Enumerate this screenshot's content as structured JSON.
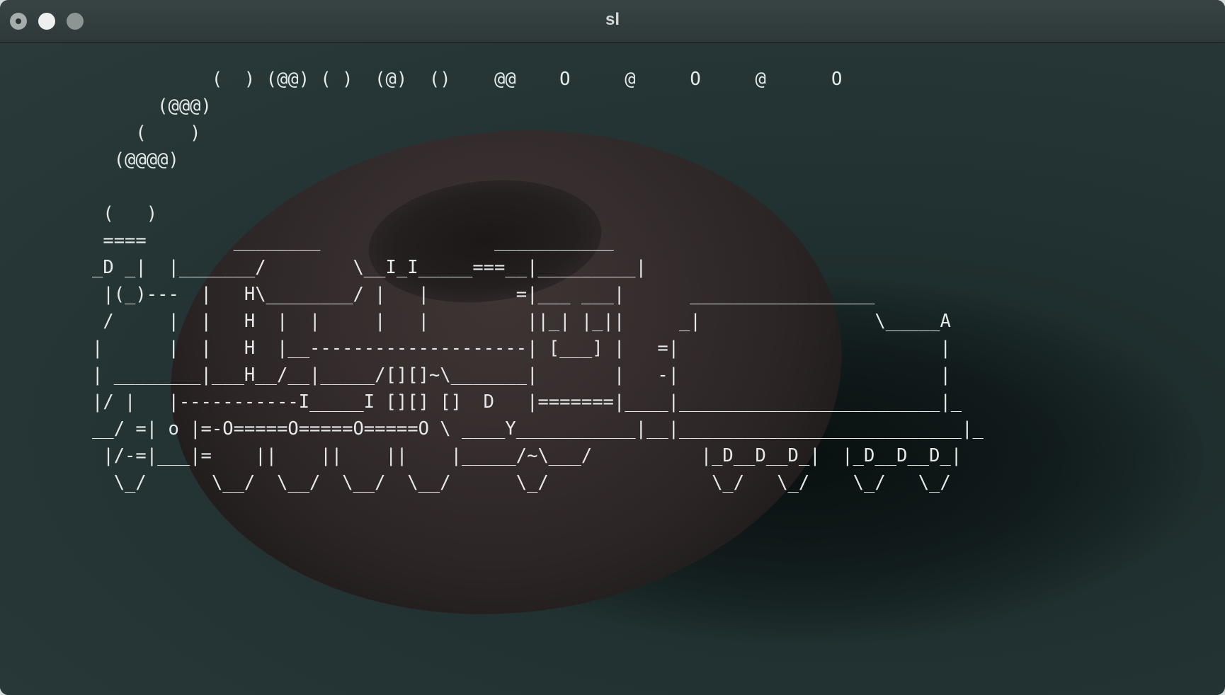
{
  "window": {
    "title": "sl"
  },
  "terminal": {
    "art_lines": [
      "           (  ) (@@) ( )  (@)  ()    @@    O     @     O     @      O",
      "      (@@@)",
      "    (    )",
      "  (@@@@)",
      "",
      " (   )",
      " ====        ________                ___________",
      "_D _|  |_______/        \\__I_I_____===__|_________|",
      " |(_)---  |   H\\________/ |   |        =|___ ___|      _________________",
      " /     |  |   H  |  |     |   |         ||_| |_||     _|                \\_____A",
      "|      |  |   H  |__--------------------| [___] |   =|                        |",
      "| ________|___H__/__|_____/[][]~\\_______|       |   -|                        |",
      "|/ |   |-----------I_____I [][] []  D   |=======|____|________________________|_",
      "__/ =| o |=-O=====O=====O=====O \\ ____Y___________|__|__________________________|_",
      " |/-=|___|=    ||    ||    ||    |_____/~\\___/          |_D__D__D_|  |_D__D__D_|",
      "  \\_/      \\__/  \\__/  \\__/  \\__/      \\_/               \\_/   \\_/    \\_/   \\_/"
    ]
  }
}
